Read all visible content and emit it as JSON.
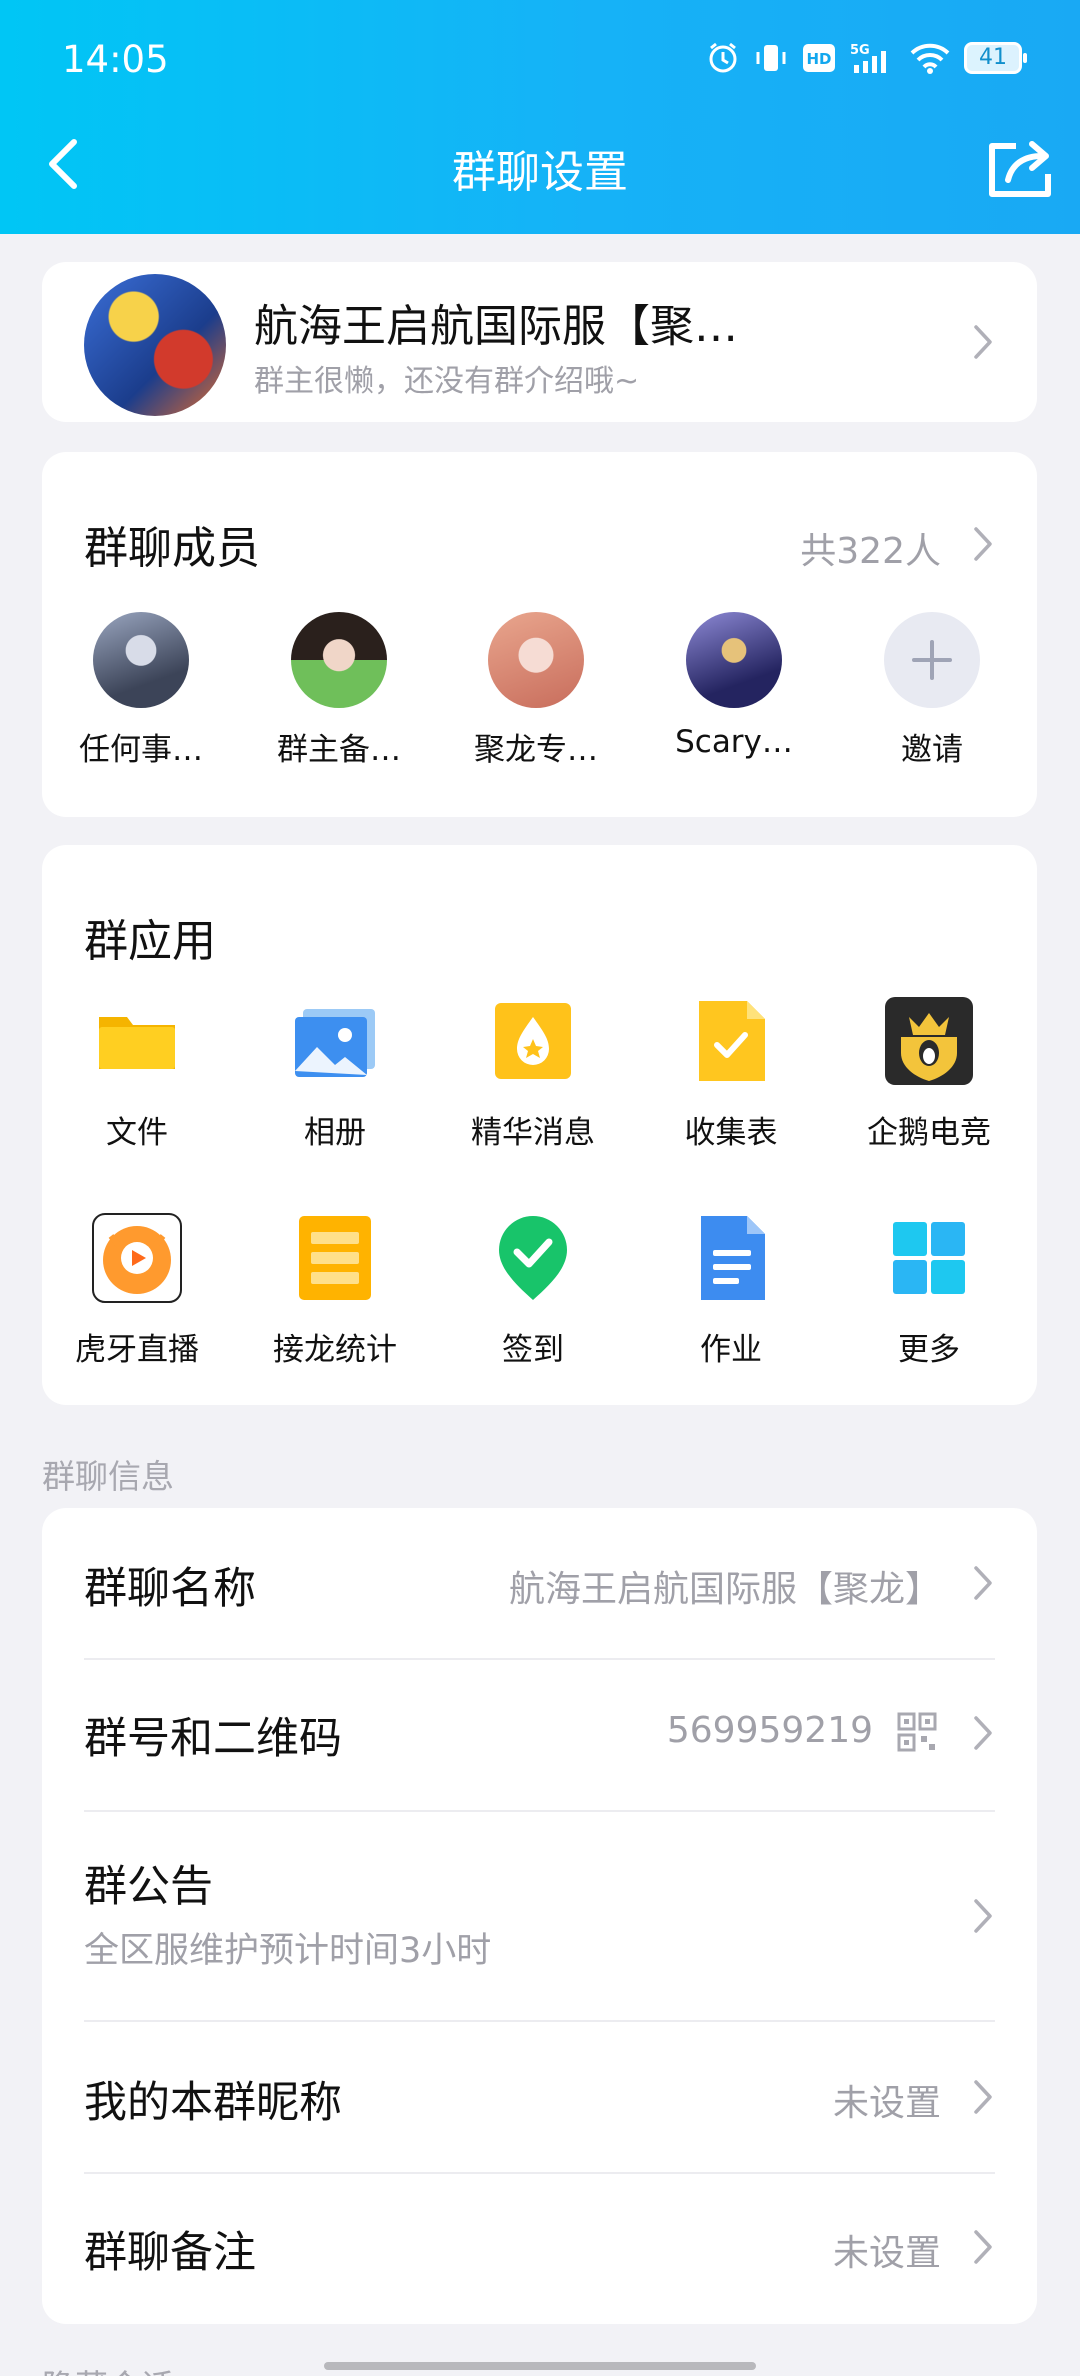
{
  "status": {
    "time": "14:05",
    "battery": "41",
    "network": "5G"
  },
  "nav": {
    "title": "群聊设置"
  },
  "group": {
    "name": "航海王启航国际服【聚…",
    "desc": "群主很懒，还没有群介绍哦~"
  },
  "members": {
    "title": "群聊成员",
    "count": "共322人",
    "items": [
      {
        "name": "任何事…"
      },
      {
        "name": "群主备…"
      },
      {
        "name": "聚龙专…"
      },
      {
        "name": "Scary…"
      },
      {
        "name": "邀请"
      }
    ]
  },
  "apps": {
    "title": "群应用",
    "items": [
      {
        "label": "文件",
        "icon": "folder-icon"
      },
      {
        "label": "相册",
        "icon": "photo-album-icon"
      },
      {
        "label": "精华消息",
        "icon": "essence-icon"
      },
      {
        "label": "收集表",
        "icon": "collection-form-icon"
      },
      {
        "label": "企鹅电竞",
        "icon": "penguin-esports-icon"
      },
      {
        "label": "虎牙直播",
        "icon": "huya-live-icon"
      },
      {
        "label": "接龙统计",
        "icon": "relay-stats-icon"
      },
      {
        "label": "签到",
        "icon": "check-in-icon"
      },
      {
        "label": "作业",
        "icon": "homework-icon"
      },
      {
        "label": "更多",
        "icon": "more-grid-icon"
      }
    ]
  },
  "info": {
    "section_label": "群聊信息",
    "rows": [
      {
        "key": "群聊名称",
        "value": "航海王启航国际服【聚龙】"
      },
      {
        "key": "群号和二维码",
        "value": "569959219"
      },
      {
        "key": "群公告",
        "sub": "全区服维护预计时间3小时"
      },
      {
        "key": "我的本群昵称",
        "value": "未设置"
      },
      {
        "key": "群聊备注",
        "value": "未设置"
      }
    ]
  },
  "next_section_label": "隐藏会话"
}
